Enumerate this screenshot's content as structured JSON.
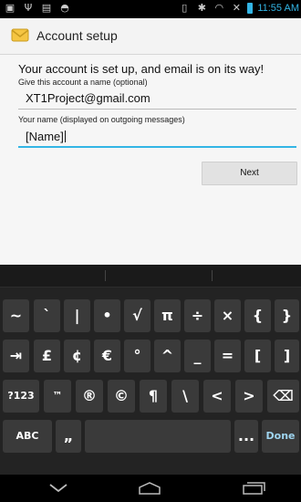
{
  "status_bar": {
    "time": "11:55 AM"
  },
  "action_bar": {
    "title": "Account setup",
    "app_icon": "email-envelope-icon"
  },
  "form": {
    "headline": "Your account is set up, and email is on its way!",
    "account_name_label": "Give this account a name (optional)",
    "account_name_value": "XT1Project@gmail.com",
    "your_name_label": "Your name (displayed on outgoing messages)",
    "your_name_value": "[Name]",
    "next_label": "Next"
  },
  "keyboard": {
    "row1": [
      "~",
      "`",
      "|",
      "•",
      "√",
      "π",
      "÷",
      "×",
      "{",
      "}"
    ],
    "row2": [
      "⇥",
      "£",
      "¢",
      "€",
      "°",
      "^",
      "_",
      "=",
      "[",
      "]"
    ],
    "row3": [
      "?123",
      "™",
      "®",
      "©",
      "¶",
      "\\",
      "<",
      ">",
      "⌫"
    ],
    "row4": {
      "abc": "ABC",
      "quote": "„",
      "space": "",
      "ellipsis": "...",
      "done": "Done"
    }
  },
  "nav": {
    "back": "back-icon",
    "home": "home-icon",
    "recents": "recents-icon"
  },
  "colors": {
    "accent": "#33b5e5",
    "keyboard_bg": "#232323",
    "key_bg": "#3a3a3a"
  }
}
